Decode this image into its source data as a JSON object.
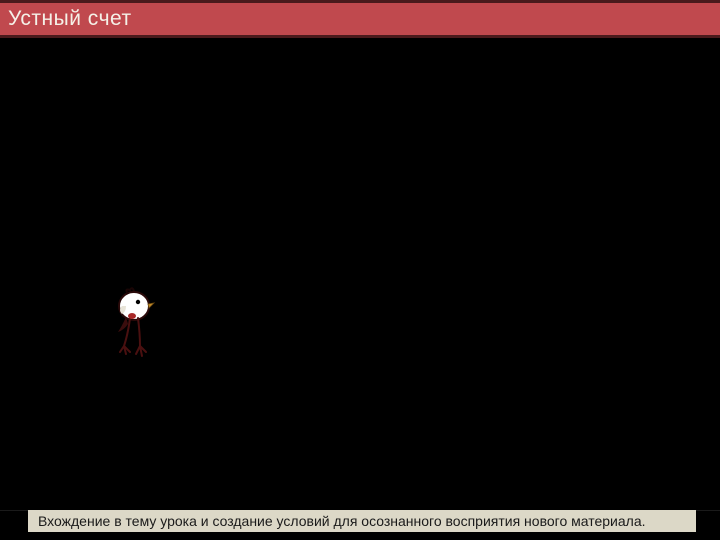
{
  "header": {
    "title": "Устный счет"
  },
  "footer": {
    "text": "Вхождение в тему урока и создание условий для осознанного восприятия нового материала."
  }
}
